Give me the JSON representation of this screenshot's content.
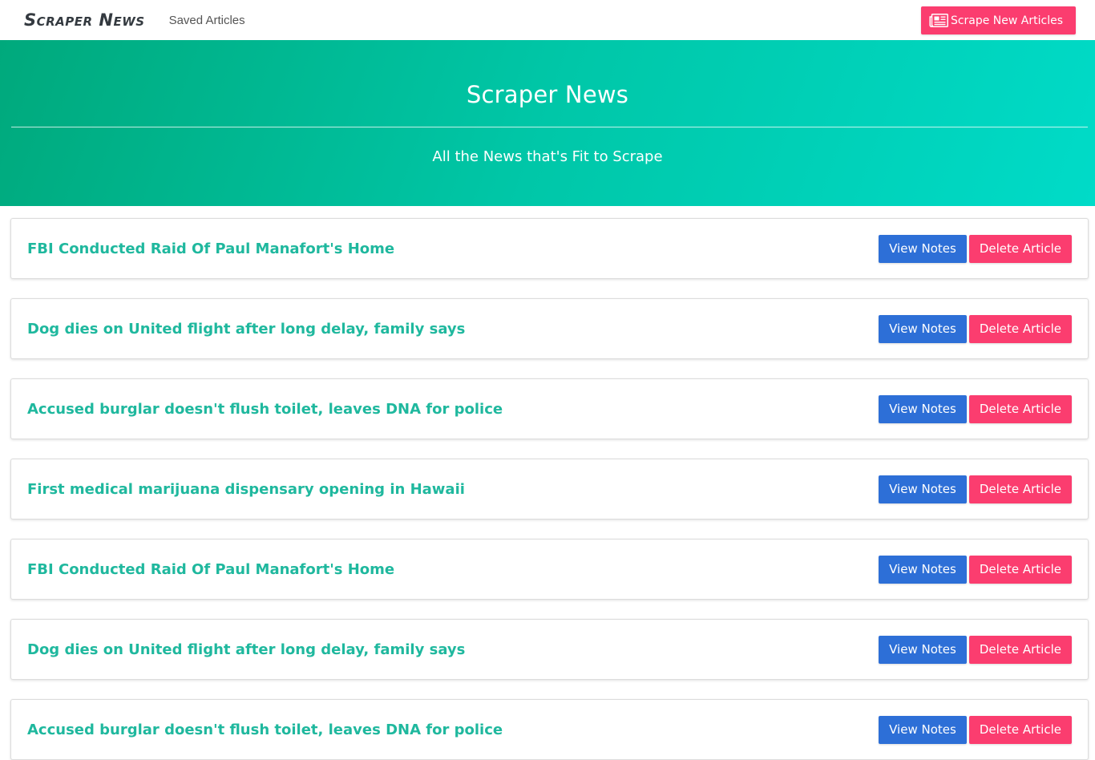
{
  "navbar": {
    "brand": "Scraper News",
    "saved_link": "Saved Articles",
    "scrape_button": "Scrape New Articles",
    "scrape_icon": "newspaper-icon"
  },
  "hero": {
    "title": "Scraper News",
    "subtitle": "All the News that's Fit to Scrape"
  },
  "articles": [
    {
      "title": "FBI Conducted Raid Of Paul Manafort's Home",
      "notes_label": "View Notes",
      "delete_label": "Delete Article"
    },
    {
      "title": "Dog dies on United flight after long delay, family says",
      "notes_label": "View Notes",
      "delete_label": "Delete Article"
    },
    {
      "title": "Accused burglar doesn't flush toilet, leaves DNA for police",
      "notes_label": "View Notes",
      "delete_label": "Delete Article"
    },
    {
      "title": "First medical marijuana dispensary opening in Hawaii",
      "notes_label": "View Notes",
      "delete_label": "Delete Article"
    },
    {
      "title": "FBI Conducted Raid Of Paul Manafort's Home",
      "notes_label": "View Notes",
      "delete_label": "Delete Article"
    },
    {
      "title": "Dog dies on United flight after long delay, family says",
      "notes_label": "View Notes",
      "delete_label": "Delete Article"
    },
    {
      "title": "Accused burglar doesn't flush toilet, leaves DNA for police",
      "notes_label": "View Notes",
      "delete_label": "Delete Article"
    }
  ],
  "colors": {
    "accent_pink": "#fb3d6f",
    "accent_blue": "#2d6fd7",
    "title_teal": "#1fb89e",
    "hero_gradient_start": "#00a97c",
    "hero_gradient_end": "#00dbc8"
  }
}
